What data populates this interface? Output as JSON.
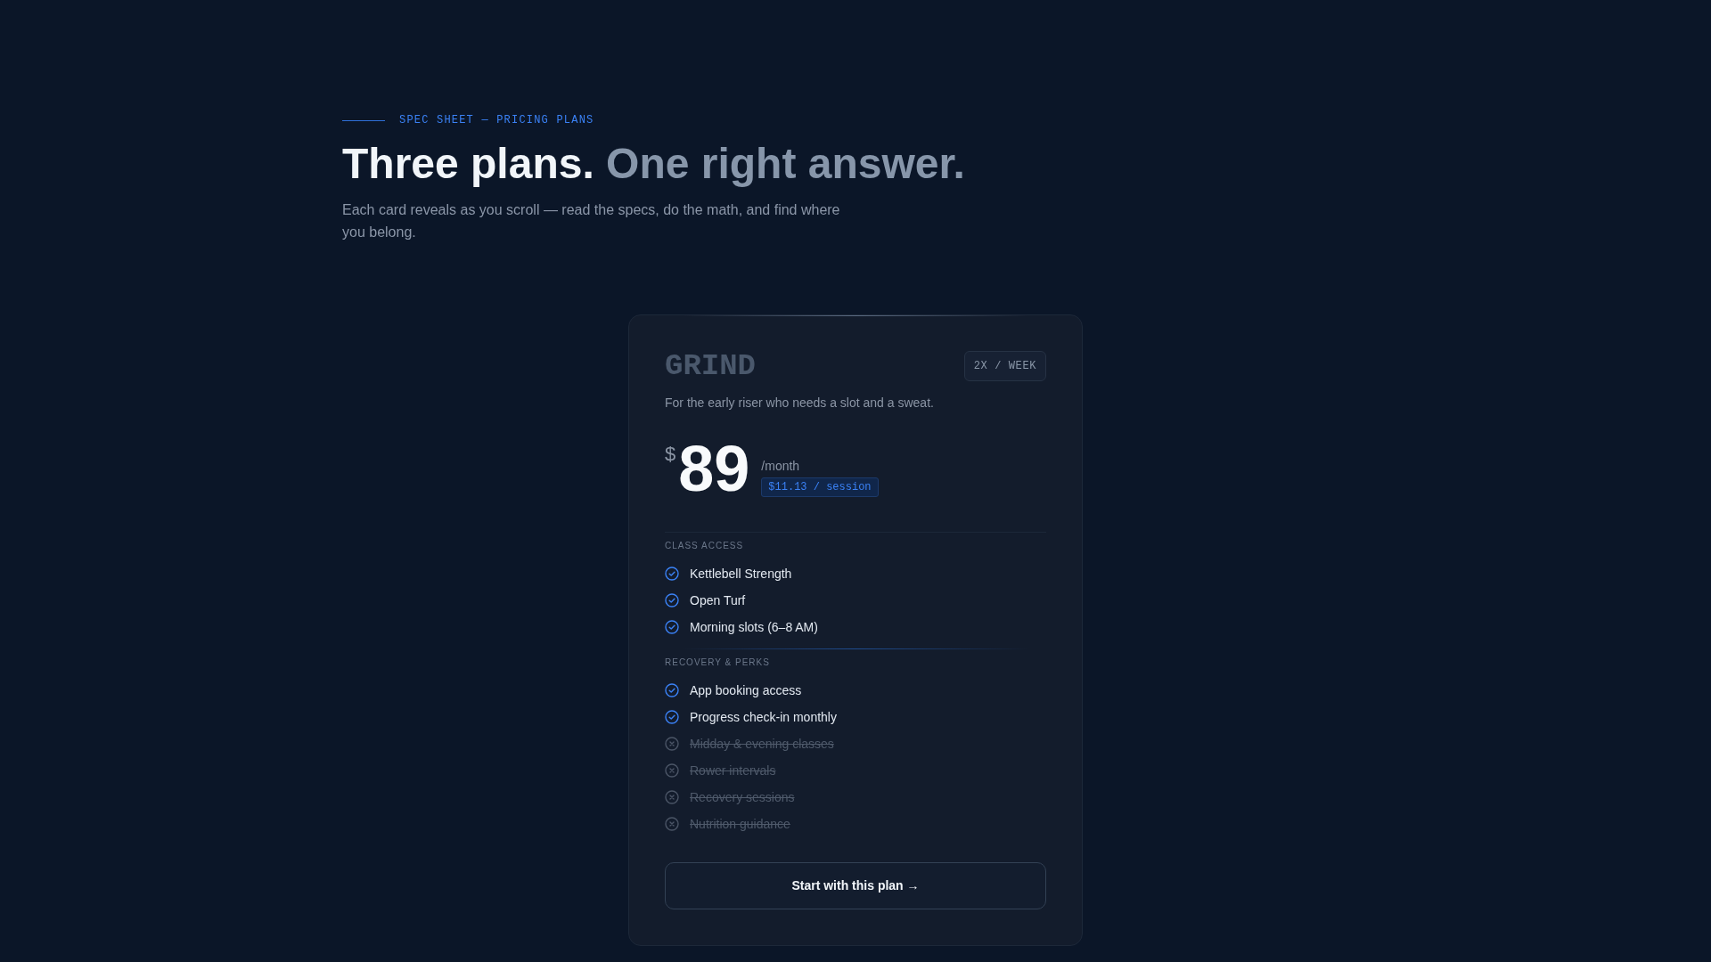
{
  "header": {
    "eyebrow": "SPEC SHEET — PRICING PLANS",
    "headline": {
      "lead": "Three plans.",
      "accent": "One right answer."
    },
    "intro": "Each card reveals as you scroll — read the specs, do the math, and find where you belong."
  },
  "plan_card": {
    "name": "GRIND",
    "frequency_badge": "2X / WEEK",
    "description": "For the early riser who needs a slot and a sweat.",
    "price": {
      "currency": "$",
      "amount": "89",
      "period": "/month",
      "per_session": "$11.13 / session"
    },
    "feature_groups": [
      {
        "title": "CLASS ACCESS",
        "features": [
          {
            "label": "Kettlebell Strength",
            "included": true
          },
          {
            "label": "Open Turf",
            "included": true
          },
          {
            "label": "Morning slots (6–8 AM)",
            "included": true
          }
        ]
      },
      {
        "title": "RECOVERY & PERKS",
        "features": [
          {
            "label": "App booking access",
            "included": true
          },
          {
            "label": "Progress check-in monthly",
            "included": true
          },
          {
            "label": "Midday & evening classes",
            "included": false
          },
          {
            "label": "Rower intervals",
            "included": false
          },
          {
            "label": "Recovery sessions",
            "included": false
          },
          {
            "label": "Nutrition guidance",
            "included": false
          }
        ]
      }
    ],
    "cta": "Start with this plan →"
  }
}
